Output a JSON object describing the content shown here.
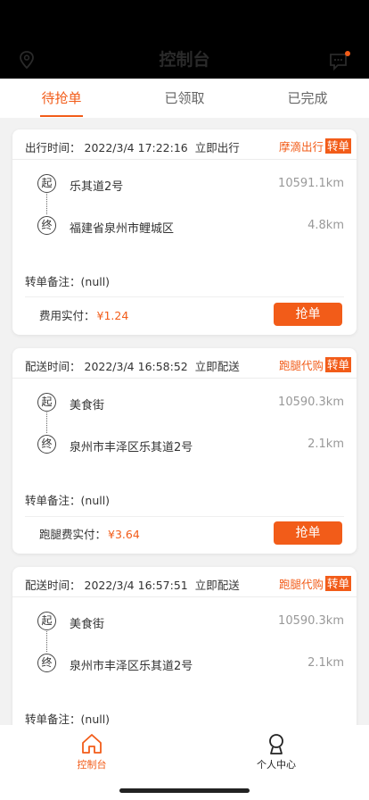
{
  "header": {
    "title": "控制台"
  },
  "tabs": [
    {
      "label": "待抢单",
      "active": true
    },
    {
      "label": "已领取",
      "active": false
    },
    {
      "label": "已完成",
      "active": false
    }
  ],
  "orders": [
    {
      "time_label": "出行时间：",
      "time": "2022/3/4 17:22:16",
      "mode": "立即出行",
      "service": "摩滴出行",
      "badge": "转单",
      "start_marker": "起",
      "end_marker": "终",
      "from": "乐其道2号",
      "from_distance": "10591.1km",
      "to": "福建省泉州市鲤城区",
      "to_distance": "4.8km",
      "note_label": "转单备注：",
      "note": "(null)",
      "fee_label": "费用实付：",
      "fee": "¥1.24",
      "button": "抢单"
    },
    {
      "time_label": "配送时间：",
      "time": "2022/3/4 16:58:52",
      "mode": "立即配送",
      "service": "跑腿代购",
      "badge": "转单",
      "start_marker": "起",
      "end_marker": "终",
      "from": "美食街",
      "from_distance": "10590.3km",
      "to": "泉州市丰泽区乐其道2号",
      "to_distance": "2.1km",
      "note_label": "转单备注：",
      "note": "(null)",
      "fee_label": "跑腿费实付：",
      "fee": "¥3.64",
      "button": "抢单"
    },
    {
      "time_label": "配送时间：",
      "time": "2022/3/4 16:57:51",
      "mode": "立即配送",
      "service": "跑腿代购",
      "badge": "转单",
      "start_marker": "起",
      "end_marker": "终",
      "from": "美食街",
      "from_distance": "10590.3km",
      "to": "泉州市丰泽区乐其道2号",
      "to_distance": "2.1km",
      "note_label": "转单备注：",
      "note": "(null)"
    }
  ],
  "tabbar": {
    "home_label": "控制台",
    "user_label": "个人中心"
  },
  "colors": {
    "accent": "#f25c19",
    "header": "#000000"
  },
  "icons": {
    "left": "location-pin-icon",
    "right": "message-icon",
    "home": "home-icon",
    "user": "user-icon"
  }
}
